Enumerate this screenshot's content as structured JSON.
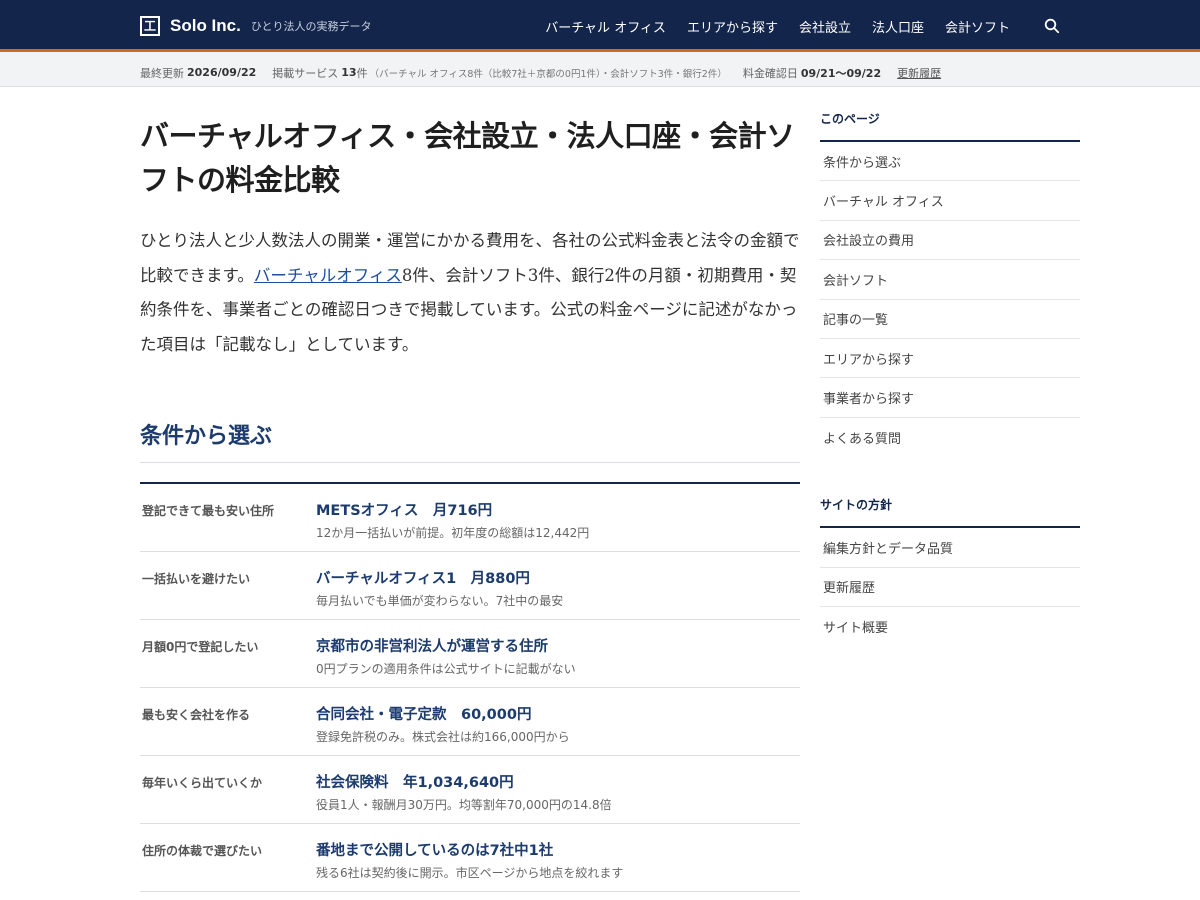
{
  "header": {
    "logo_glyph": "工",
    "site_name": "Solo Inc.",
    "tagline": "ひとり法人の実務データ",
    "nav": [
      {
        "label": "バーチャル オフィス"
      },
      {
        "label": "エリアから探す"
      },
      {
        "label": "会社設立"
      },
      {
        "label": "法人口座"
      },
      {
        "label": "会計ソフト"
      }
    ],
    "search_icon": "search-icon"
  },
  "status": {
    "updated_label": "最終更新",
    "updated_value": "2026/09/22",
    "services_label": "掲載サービス",
    "services_count": "13",
    "services_unit": "件",
    "services_detail": "（バーチャル オフィス8件（比較7社＋京都の0円1件）・会計ソフト3件・銀行2件）",
    "price_check_label": "料金確認日",
    "price_check_value": "09/21〜09/22",
    "history_link": "更新履歴"
  },
  "main": {
    "title": "バーチャルオフィス・会社設立・法人口座・会計ソフトの料金比較",
    "intro_before": "ひとり法人と少人数法人の開業・運営にかかる費用を、各社の公式料金表と法令の金額で比較できます。",
    "intro_link": "バーチャルオフィス",
    "intro_after": "8件、会計ソフト3件、銀行2件の月額・初期費用・契約条件を、事業者ごとの確認日つきで掲載しています。公式の料金ページに記述がなかった項目は「記載なし」としています。",
    "section_title": "条件から選ぶ",
    "conditions": [
      {
        "label": "登記できて最も安い住所",
        "main": "METSオフィス　月716円",
        "sub": "12か月一括払いが前提。初年度の総額は12,442円"
      },
      {
        "label": "一括払いを避けたい",
        "main": "バーチャルオフィス1　月880円",
        "sub": "毎月払いでも単価が変わらない。7社中の最安"
      },
      {
        "label": "月額0円で登記したい",
        "main": "京都市の非営利法人が運営する住所",
        "sub": "0円プランの適用条件は公式サイトに記載がない"
      },
      {
        "label": "最も安く会社を作る",
        "main": "合同会社・電子定款　60,000円",
        "sub": "登録免許税のみ。株式会社は約166,000円から"
      },
      {
        "label": "毎年いくら出ていくか",
        "main": "社会保険料　年1,034,640円",
        "sub": "役員1人・報酬月30万円。均等割年70,000円の14.8倍"
      },
      {
        "label": "住所の体裁で選びたい",
        "main": "番地まで公開しているのは7社中1社",
        "sub": "残る6社は契約後に開示。市区ページから地点を絞れます"
      }
    ]
  },
  "sidebar": {
    "page_heading": "このページ",
    "page_items": [
      {
        "label": "条件から選ぶ"
      },
      {
        "label": "バーチャル オフィス"
      },
      {
        "label": "会社設立の費用"
      },
      {
        "label": "会計ソフト"
      },
      {
        "label": "記事の一覧"
      },
      {
        "label": "エリアから探す"
      },
      {
        "label": "事業者から探す"
      },
      {
        "label": "よくある質問"
      }
    ],
    "policy_heading": "サイトの方針",
    "policy_items": [
      {
        "label": "編集方針とデータ品質"
      },
      {
        "label": "更新履歴"
      },
      {
        "label": "サイト概要"
      }
    ]
  }
}
